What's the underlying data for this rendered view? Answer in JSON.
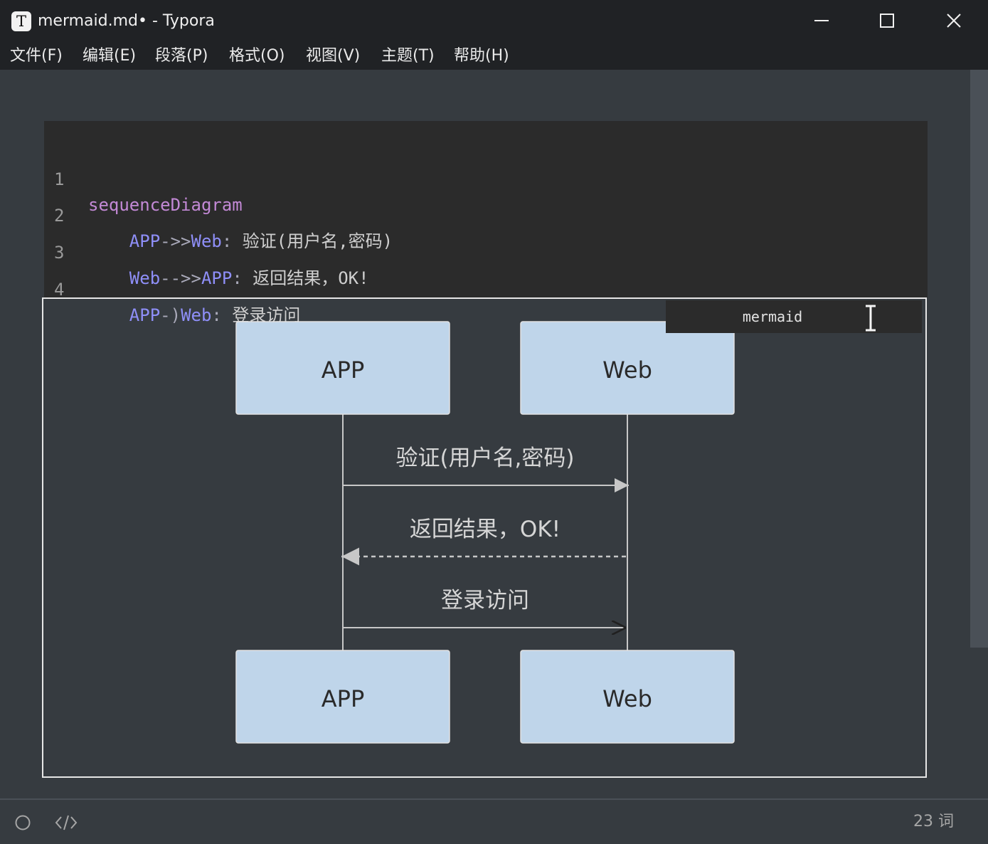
{
  "window": {
    "title": "mermaid.md• - Typora",
    "logo_letter": "T",
    "controls": [
      "minimize",
      "maximize",
      "close"
    ]
  },
  "menu": [
    "文件(F)",
    "编辑(E)",
    "段落(P)",
    "格式(O)",
    "视图(V)",
    "主题(T)",
    "帮助(H)"
  ],
  "code": {
    "line_numbers": [
      "1",
      "2",
      "3",
      "4"
    ],
    "lines": [
      [
        {
          "t": "sequenceDiagram",
          "c": "kw"
        }
      ],
      [
        {
          "t": "    ",
          "c": "plain"
        },
        {
          "t": "APP",
          "c": "actor"
        },
        {
          "t": "->>",
          "c": "arrow"
        },
        {
          "t": "Web",
          "c": "actor"
        },
        {
          "t": ": ",
          "c": "arrow"
        },
        {
          "t": "验证(用户名,密码)",
          "c": "plain"
        }
      ],
      [
        {
          "t": "    ",
          "c": "plain"
        },
        {
          "t": "Web",
          "c": "actor"
        },
        {
          "t": "-->>",
          "c": "arrow"
        },
        {
          "t": "APP",
          "c": "actor"
        },
        {
          "t": ": ",
          "c": "arrow"
        },
        {
          "t": "返回结果，OK!",
          "c": "plain"
        }
      ],
      [
        {
          "t": "    ",
          "c": "plain"
        },
        {
          "t": "APP",
          "c": "actor"
        },
        {
          "t": "-)",
          "c": "arrow"
        },
        {
          "t": "Web",
          "c": "actor"
        },
        {
          "t": ": ",
          "c": "arrow"
        },
        {
          "t": "登录访问",
          "c": "plain"
        }
      ]
    ],
    "language": "mermaid"
  },
  "diagram": {
    "actor_left": "APP",
    "actor_right": "Web",
    "messages": [
      {
        "label": "验证(用户名,密码)",
        "from": "APP",
        "to": "Web",
        "style": "solid-filled-arrow"
      },
      {
        "label": "返回结果，OK!",
        "from": "Web",
        "to": "APP",
        "style": "dashed-filled-arrow"
      },
      {
        "label": "登录访问",
        "from": "APP",
        "to": "Web",
        "style": "solid-open-arrow"
      }
    ],
    "actor_fill": "#bfd5ea",
    "line_color": "#c7c7c7"
  },
  "status": {
    "word_count": "23 词",
    "icons": [
      "outline-toggle-icon",
      "source-code-icon"
    ]
  },
  "colors": {
    "editor_bg": "#363b40",
    "titlebar_bg": "#202225",
    "code_bg": "#2b2b2b",
    "keyword": "#c389d6",
    "actor": "#8f8ff8"
  }
}
